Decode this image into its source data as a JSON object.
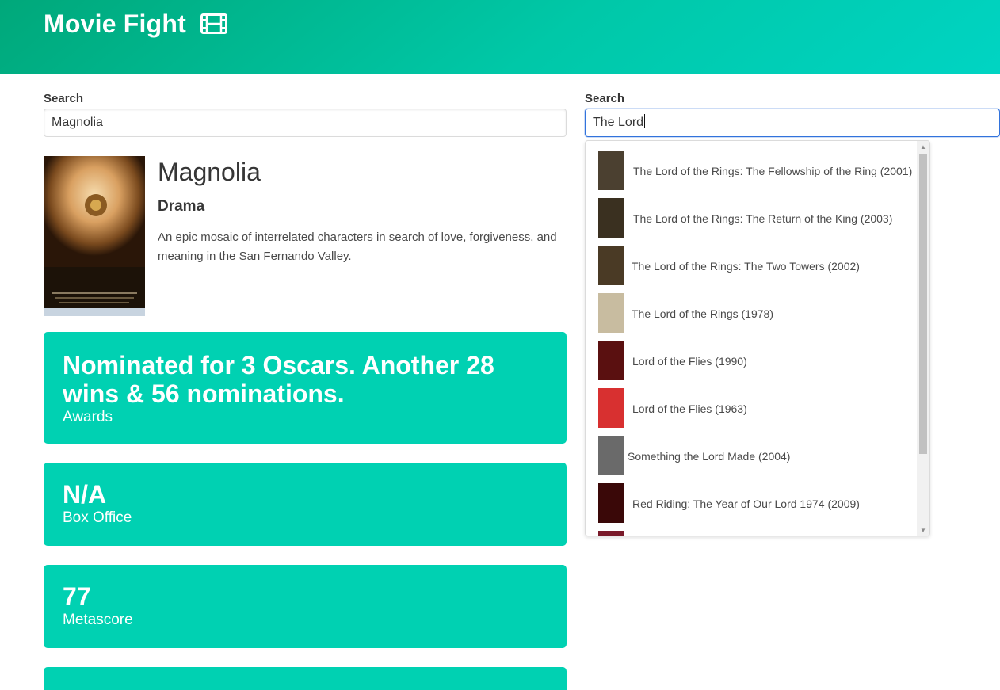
{
  "app": {
    "title": "Movie Fight",
    "icon": "film-icon"
  },
  "left": {
    "search_label": "Search",
    "search_value": "Magnolia",
    "movie": {
      "title": "Magnolia",
      "genre": "Drama",
      "plot": "An epic mosaic of interrelated characters in search of love, forgiveness, and meaning in the San Fernando Valley.",
      "poster_text": "magnolia"
    },
    "stats": [
      {
        "value": "Nominated for 3 Oscars. Another 28 wins & 56 nominations.",
        "label": "Awards"
      },
      {
        "value": "N/A",
        "label": "Box Office"
      },
      {
        "value": "77",
        "label": "Metascore"
      },
      {
        "value": "",
        "label": ""
      }
    ]
  },
  "right": {
    "search_label": "Search",
    "search_value": "The Lord",
    "results": [
      {
        "title": "The Lord of the Rings: The Fellowship of the Ring (2001)",
        "thumb": "#4b4030"
      },
      {
        "title": "The Lord of the Rings: The Return of the King (2003)",
        "thumb": "#3a3020"
      },
      {
        "title": "The Lord of the Rings: The Two Towers (2002)",
        "thumb": "#4a3a25"
      },
      {
        "title": "The Lord of the Rings (1978)",
        "thumb": "#c8bca0"
      },
      {
        "title": "Lord of the Flies (1990)",
        "thumb": "#5a1010"
      },
      {
        "title": "Lord of the Flies (1963)",
        "thumb": "#d83030"
      },
      {
        "title": "Something the Lord Made (2004)",
        "thumb": "#6a6a6a"
      },
      {
        "title": "Red Riding: The Year of Our Lord 1974 (2009)",
        "thumb": "#3a0808"
      }
    ]
  },
  "colors": {
    "primary": "#00d1b2",
    "hero_start": "#00a87a",
    "hero_end": "#00d4c3",
    "focus": "#3273dc"
  }
}
